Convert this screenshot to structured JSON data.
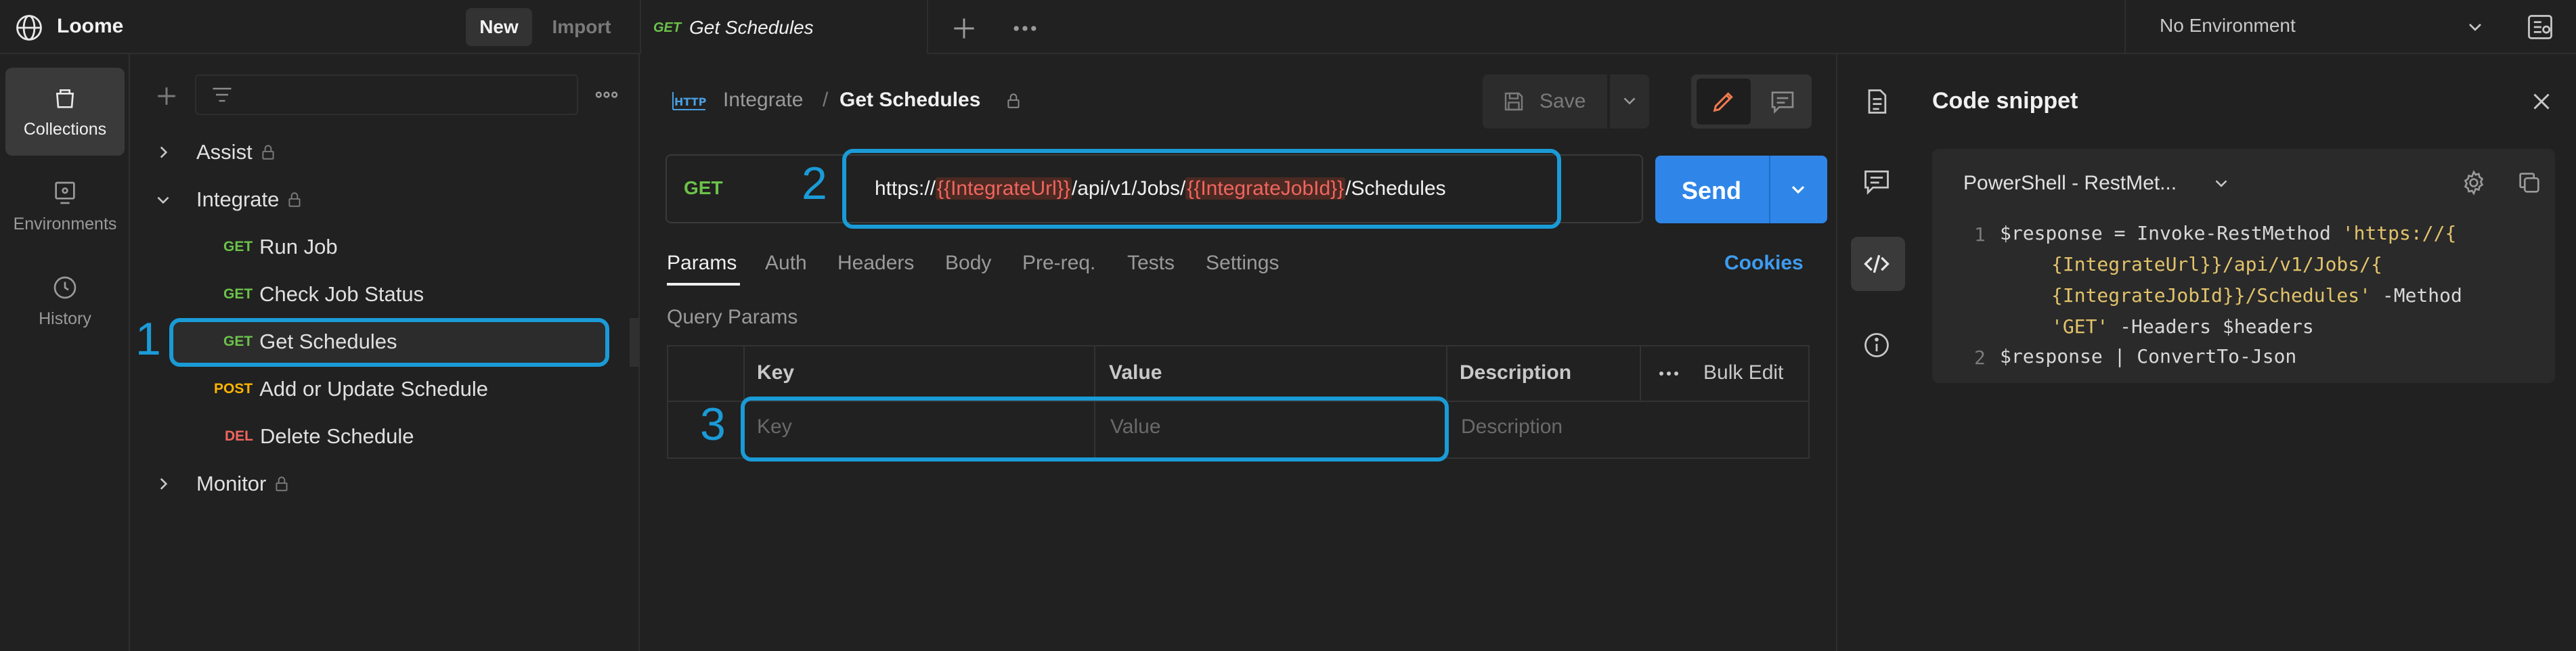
{
  "app": {
    "name": "Loome",
    "new_label": "New",
    "import_label": "Import"
  },
  "tabs": [
    {
      "method": "GET",
      "title": "Get Schedules"
    }
  ],
  "environment": {
    "selected": "No Environment"
  },
  "nav": [
    {
      "label": "Collections",
      "icon": "collections-icon"
    },
    {
      "label": "Environments",
      "icon": "environments-icon"
    },
    {
      "label": "History",
      "icon": "history-icon"
    }
  ],
  "tree": {
    "folders": [
      {
        "name": "Assist"
      },
      {
        "name": "Integrate",
        "requests": [
          {
            "method": "GET",
            "name": "Run Job"
          },
          {
            "method": "GET",
            "name": "Check Job Status"
          },
          {
            "method": "GET",
            "name": "Get Schedules"
          },
          {
            "method": "POST",
            "name": "Add or Update Schedule"
          },
          {
            "method": "DEL",
            "name": "Delete Schedule"
          }
        ]
      },
      {
        "name": "Monitor"
      }
    ]
  },
  "annotations": [
    "1",
    "2",
    "3"
  ],
  "request": {
    "breadcrumb_parent": "Integrate",
    "breadcrumb_sep": "/",
    "title": "Get Schedules",
    "save_label": "Save",
    "method": "GET",
    "url_parts": [
      "https://",
      "{{IntegrateUrl}}",
      "/api/v1/Jobs/",
      "{{IntegrateJobId}}",
      "/Schedules"
    ],
    "send_label": "Send"
  },
  "request_tabs": [
    "Params",
    "Auth",
    "Headers",
    "Body",
    "Pre-req.",
    "Tests",
    "Settings"
  ],
  "cookies_label": "Cookies",
  "query_params": {
    "label": "Query Params",
    "columns": [
      "Key",
      "Value",
      "Description"
    ],
    "bulk_edit": "Bulk Edit",
    "placeholders": {
      "key": "Key",
      "value": "Value",
      "description": "Description"
    }
  },
  "code_snippet": {
    "title": "Code snippet",
    "language": "PowerShell - RestMet...",
    "lines": [
      {
        "num": "1",
        "text": "$response = Invoke-RestMethod ",
        "str1": "'https://{",
        "str2": "{IntegrateUrl}}/api/v1/Jobs/{",
        "str3": "{IntegrateJobId}}/Schedules'",
        "tail3": " -Method",
        "str4": "'GET'",
        "tail4": " -Headers $headers"
      },
      {
        "num": "2",
        "text": "$response | ConvertTo-Json"
      }
    ]
  }
}
